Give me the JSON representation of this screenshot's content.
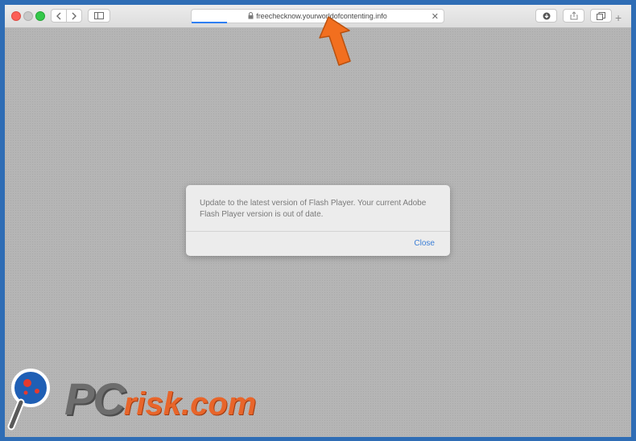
{
  "browser": {
    "url": "freechecknow.yourworldofcontenting.info",
    "page_load_progress": 0.14,
    "new_tab_label": "+"
  },
  "alert": {
    "message": "Update to the latest version of Flash Player. Your current Adobe Flash Player version is out of date.",
    "close_label": "Close"
  },
  "watermark": {
    "brand": "PC",
    "suffix": "risk.com"
  },
  "colors": {
    "accent": "#3d7fd6",
    "arrow": "#f26f1f",
    "watermark_orange": "#e8652a"
  },
  "icons": [
    "close-dot-icon",
    "minimize-dot-icon",
    "zoom-dot-icon",
    "chevron-left-icon",
    "chevron-right-icon",
    "sidebar-icon",
    "lock-icon",
    "close-icon",
    "download-icon",
    "share-icon",
    "tabs-icon",
    "plus-icon",
    "arrow-icon",
    "magnifier-logo-icon"
  ]
}
